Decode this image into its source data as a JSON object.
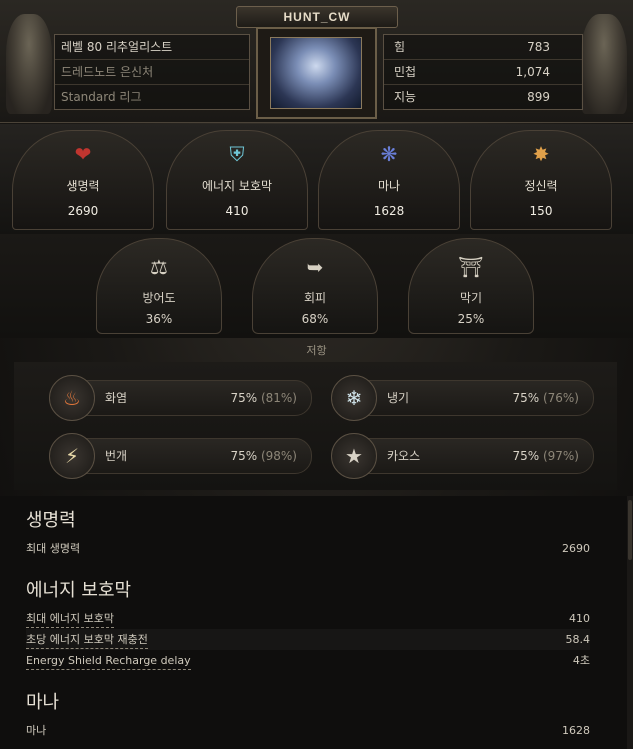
{
  "header": {
    "character_name": "HUNT_CW",
    "level_class": "레벨 80 리추얼리스트",
    "ascendancy": "드레드노트 은신처",
    "league": "Standard 리그",
    "attributes": [
      {
        "label": "힘",
        "value": "783"
      },
      {
        "label": "민첩",
        "value": "1,074"
      },
      {
        "label": "지능",
        "value": "899"
      }
    ]
  },
  "primary_stats": [
    {
      "label": "생명력",
      "value": "2690",
      "icon": "heart-icon"
    },
    {
      "label": "에너지 보호막",
      "value": "410",
      "icon": "energy-shield-icon"
    },
    {
      "label": "마나",
      "value": "1628",
      "icon": "mana-icon"
    },
    {
      "label": "정신력",
      "value": "150",
      "icon": "spirit-icon"
    }
  ],
  "defence_stats": [
    {
      "label": "방어도",
      "value": "36%",
      "icon": "armour-icon"
    },
    {
      "label": "회피",
      "value": "68%",
      "icon": "evasion-icon"
    },
    {
      "label": "막기",
      "value": "25%",
      "icon": "block-icon"
    }
  ],
  "resistances": {
    "title": "저항",
    "items": [
      {
        "label": "화염",
        "value": "75%",
        "max": "(81%)",
        "icon": "fire-icon"
      },
      {
        "label": "냉기",
        "value": "75%",
        "max": "(76%)",
        "icon": "cold-icon"
      },
      {
        "label": "번개",
        "value": "75%",
        "max": "(98%)",
        "icon": "lightning-icon"
      },
      {
        "label": "카오스",
        "value": "75%",
        "max": "(97%)",
        "icon": "chaos-icon"
      }
    ]
  },
  "details": {
    "life": {
      "title": "생명력",
      "rows": [
        {
          "label": "최대 생명력",
          "value": "2690"
        }
      ]
    },
    "energy_shield": {
      "title": "에너지 보호막",
      "rows": [
        {
          "label": "최대 에너지 보호막",
          "value": "410"
        },
        {
          "label": "초당 에너지 보호막 재충전",
          "value": "58.4"
        },
        {
          "label": "Energy Shield Recharge delay",
          "value": "4초"
        }
      ]
    },
    "mana": {
      "title": "마나",
      "rows": [
        {
          "label": "마나",
          "value": "1628"
        }
      ]
    }
  },
  "colors": {
    "life": "#c0352f",
    "energy_shield": "#6fc6d6",
    "mana": "#6a7fd8",
    "spirit": "#e0a04a"
  }
}
